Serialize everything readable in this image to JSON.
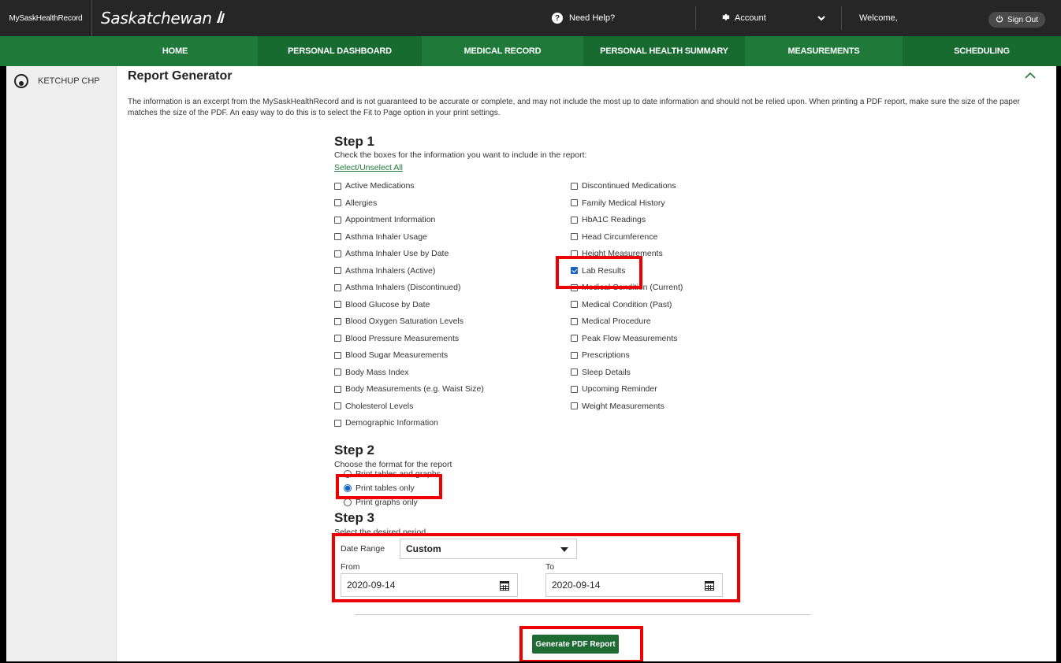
{
  "header": {
    "brand_text": "MySaskHealthRecord",
    "province_text": "Saskatchewan",
    "help_label": "Need Help?",
    "account_label": "Account",
    "welcome_label": "Welcome,",
    "signout_label": "Sign Out"
  },
  "nav": {
    "items": [
      {
        "label": "HOME"
      },
      {
        "label": "PERSONAL DASHBOARD"
      },
      {
        "label": "MEDICAL RECORD"
      },
      {
        "label": "PERSONAL HEALTH SUMMARY"
      },
      {
        "label": "MEASUREMENTS"
      },
      {
        "label": "SCHEDULING"
      }
    ]
  },
  "sidebar": {
    "patient_name": "KETCHUP CHP"
  },
  "page": {
    "title": "Report Generator",
    "disclaimer": "The information is an excerpt from the MySaskHealthRecord and is not guaranteed to be accurate or complete, and may not include the most up to date information and should not be relied upon. When printing a PDF report, make sure the size of the paper matches the size of the PDF. An easy way to do this is to select the Fit to Page option in your print settings."
  },
  "step1": {
    "heading": "Step 1",
    "instructions": "Check the boxes for the information you want to include in the report:",
    "select_all_label": "Select/Unselect All",
    "left_options": [
      {
        "label": "Active Medications",
        "checked": false
      },
      {
        "label": "Allergies",
        "checked": false
      },
      {
        "label": "Appointment Information",
        "checked": false
      },
      {
        "label": "Asthma Inhaler Usage",
        "checked": false
      },
      {
        "label": "Asthma Inhaler Use by Date",
        "checked": false
      },
      {
        "label": "Asthma Inhalers (Active)",
        "checked": false
      },
      {
        "label": "Asthma Inhalers (Discontinued)",
        "checked": false
      },
      {
        "label": "Blood Glucose by Date",
        "checked": false
      },
      {
        "label": "Blood Oxygen Saturation Levels",
        "checked": false
      },
      {
        "label": "Blood Pressure Measurements",
        "checked": false
      },
      {
        "label": "Blood Sugar Measurements",
        "checked": false
      },
      {
        "label": "Body Mass Index",
        "checked": false
      },
      {
        "label": "Body Measurements (e.g. Waist Size)",
        "checked": false
      },
      {
        "label": "Cholesterol Levels",
        "checked": false
      },
      {
        "label": "Demographic Information",
        "checked": false
      }
    ],
    "right_options": [
      {
        "label": "Discontinued Medications",
        "checked": false
      },
      {
        "label": "Family Medical History",
        "checked": false
      },
      {
        "label": "HbA1C Readings",
        "checked": false
      },
      {
        "label": "Head Circumference",
        "checked": false
      },
      {
        "label": "Height Measurements",
        "checked": false
      },
      {
        "label": "Lab Results",
        "checked": true
      },
      {
        "label": "Medical Condition (Current)",
        "checked": false
      },
      {
        "label": "Medical Condition (Past)",
        "checked": false
      },
      {
        "label": "Medical Procedure",
        "checked": false
      },
      {
        "label": "Peak Flow Measurements",
        "checked": false
      },
      {
        "label": "Prescriptions",
        "checked": false
      },
      {
        "label": "Sleep Details",
        "checked": false
      },
      {
        "label": "Upcoming Reminder",
        "checked": false
      },
      {
        "label": "Weight Measurements",
        "checked": false
      }
    ]
  },
  "step2": {
    "heading": "Step 2",
    "instructions": "Choose the format for the report",
    "options": [
      {
        "label": "Print tables and graphs",
        "checked": false
      },
      {
        "label": "Print tables only",
        "checked": true
      },
      {
        "label": "Print graphs only",
        "checked": false
      }
    ]
  },
  "step3": {
    "heading": "Step 3",
    "instructions": "Select the desired period",
    "date_range_label": "Date Range",
    "date_range_value": "Custom",
    "from_label": "From",
    "from_value": "2020-09-14",
    "to_label": "To",
    "to_value": "2020-09-14"
  },
  "generate_button_label": "Generate PDF Report",
  "colors": {
    "nav_green": "#1f7a3a",
    "topbar": "#262626",
    "highlight": "#ee0000"
  }
}
